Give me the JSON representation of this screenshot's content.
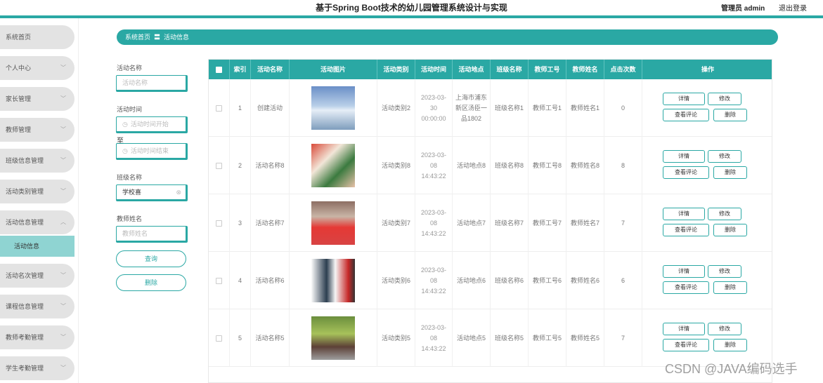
{
  "header": {
    "title": "基于Spring Boot技术的幼儿园管理系统设计与实现",
    "user": "管理员 admin",
    "logout": "退出登录"
  },
  "sidebar": {
    "items": [
      {
        "label": "系统首页"
      },
      {
        "label": "个人中心"
      },
      {
        "label": "家长管理"
      },
      {
        "label": "教师管理"
      },
      {
        "label": "班级信息管理"
      },
      {
        "label": "活动类别管理"
      },
      {
        "label": "活动信息管理"
      },
      {
        "label": "活动名次管理"
      },
      {
        "label": "课程信息管理"
      },
      {
        "label": "教师考勤管理"
      },
      {
        "label": "学生考勤管理"
      }
    ],
    "active_sub": "活动信息"
  },
  "breadcrumb": {
    "home": "系统首页",
    "separator": "〓",
    "current": "活动信息"
  },
  "search": {
    "name_label": "活动名称",
    "name_placeholder": "活动名称",
    "time_label": "活动时间",
    "time_start_placeholder": "活动时间开始",
    "to_label": "至",
    "time_end_placeholder": "活动时间结束",
    "class_label": "班级名称",
    "class_value": "学校喜",
    "teacher_label": "教师姓名",
    "teacher_placeholder": "教师姓名",
    "query_button": "查询",
    "delete_button": "删除"
  },
  "table": {
    "columns": [
      "索引",
      "活动名称",
      "活动图片",
      "活动类别",
      "活动时间",
      "活动地点",
      "班级名称",
      "教师工号",
      "教师姓名",
      "点击次数",
      "操作"
    ],
    "rows": [
      {
        "index": "1",
        "name": "创建活动",
        "category": "活动类别2",
        "time": "2023-03-30 00:00:00",
        "place": "上海市浦东新区汤臣一品1802",
        "class": "班级名称1",
        "teacher_no": "教师工号1",
        "teacher_name": "教师姓名1",
        "clicks": "0"
      },
      {
        "index": "2",
        "name": "活动名称8",
        "category": "活动类别8",
        "time": "2023-03-08 14:43:22",
        "place": "活动地点8",
        "class": "班级名称8",
        "teacher_no": "教师工号8",
        "teacher_name": "教师姓名8",
        "clicks": "8"
      },
      {
        "index": "3",
        "name": "活动名称7",
        "category": "活动类别7",
        "time": "2023-03-08 14:43:22",
        "place": "活动地点7",
        "class": "班级名称7",
        "teacher_no": "教师工号7",
        "teacher_name": "教师姓名7",
        "clicks": "7"
      },
      {
        "index": "4",
        "name": "活动名称6",
        "category": "活动类别6",
        "time": "2023-03-08 14:43:22",
        "place": "活动地点6",
        "class": "班级名称6",
        "teacher_no": "教师工号6",
        "teacher_name": "教师姓名6",
        "clicks": "6"
      },
      {
        "index": "5",
        "name": "活动名称5",
        "category": "活动类别5",
        "time": "2023-03-08 14:43:22",
        "place": "活动地点5",
        "class": "班级名称5",
        "teacher_no": "教师工号5",
        "teacher_name": "教师姓名5",
        "clicks": "7"
      }
    ],
    "actions": {
      "detail": "详情",
      "edit": "修改",
      "comments": "查看评论",
      "delete": "删除"
    }
  },
  "watermark": "CSDN @JAVA编码选手",
  "colors": {
    "accent": "#2aa8a4",
    "sidebar_item": "#e3e3e3",
    "sidebar_active": "#8fd4d2"
  }
}
